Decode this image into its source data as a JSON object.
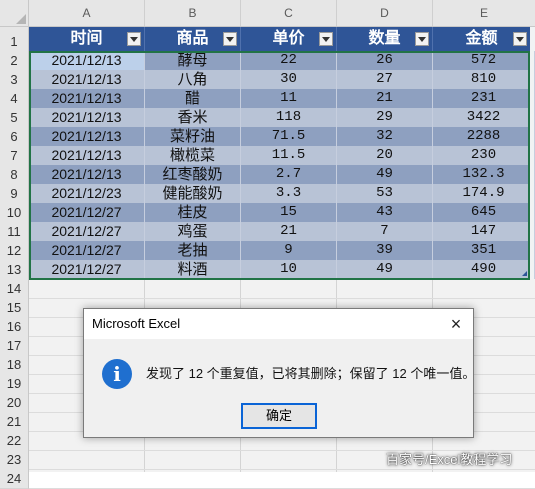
{
  "columns": [
    "A",
    "B",
    "C",
    "D",
    "E"
  ],
  "header": [
    "时间",
    "商品",
    "单价",
    "数量",
    "金额"
  ],
  "rows": [
    [
      "2021/12/13",
      "酵母",
      "22",
      "26",
      "572"
    ],
    [
      "2021/12/13",
      "八角",
      "30",
      "27",
      "810"
    ],
    [
      "2021/12/13",
      "醋",
      "11",
      "21",
      "231"
    ],
    [
      "2021/12/13",
      "香米",
      "118",
      "29",
      "3422"
    ],
    [
      "2021/12/13",
      "菜籽油",
      "71.5",
      "32",
      "2288"
    ],
    [
      "2021/12/13",
      "橄榄菜",
      "11.5",
      "20",
      "230"
    ],
    [
      "2021/12/13",
      "红枣酸奶",
      "2.7",
      "49",
      "132.3"
    ],
    [
      "2021/12/23",
      "健能酸奶",
      "3.3",
      "53",
      "174.9"
    ],
    [
      "2021/12/27",
      "桂皮",
      "15",
      "43",
      "645"
    ],
    [
      "2021/12/27",
      "鸡蛋",
      "21",
      "7",
      "147"
    ],
    [
      "2021/12/27",
      "老抽",
      "9",
      "39",
      "351"
    ],
    [
      "2021/12/27",
      "料酒",
      "10",
      "49",
      "490"
    ]
  ],
  "row_numbers": [
    "1",
    "2",
    "3",
    "4",
    "5",
    "6",
    "7",
    "8",
    "9",
    "10",
    "11",
    "12",
    "13",
    "14",
    "15",
    "16",
    "17",
    "18",
    "19",
    "20",
    "21",
    "22",
    "23",
    "24"
  ],
  "dialog": {
    "title": "Microsoft Excel",
    "close": "×",
    "icon_glyph": "i",
    "message": "发现了 12 个重复值，已将其删除；保留了 12 个唯一值。",
    "ok_label": "确定"
  },
  "watermark": "百家号/Excel教程学习",
  "colors": {
    "header_bg": "#2f5597",
    "row_dark": "#8ea0c0",
    "row_light": "#b8c3d6",
    "selection_border": "#217346",
    "info_icon": "#1f6fcf"
  }
}
